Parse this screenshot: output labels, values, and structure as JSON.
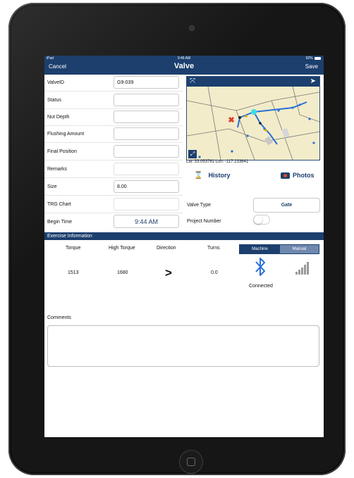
{
  "status_bar": {
    "carrier": "iPad",
    "time": "9:46 AM",
    "battery": "92%"
  },
  "nav": {
    "cancel": "Cancel",
    "title": "Valve",
    "save": "Save"
  },
  "form": {
    "valve_id": {
      "label": "ValveID",
      "value": "G9-039"
    },
    "status": {
      "label": "Status",
      "value": ""
    },
    "nut_depth": {
      "label": "Nut Depth",
      "value": ""
    },
    "flushing_amount": {
      "label": "Flushing Amount",
      "value": ""
    },
    "final_position": {
      "label": "Final Position",
      "value": ""
    },
    "remarks": {
      "label": "Remarks",
      "value": ""
    },
    "size": {
      "label": "Size",
      "value": "8.00"
    },
    "trg_chart": {
      "label": "TRG Chart",
      "value": ""
    },
    "begin_time": {
      "label": "Begin Time",
      "value": "9:44 AM"
    }
  },
  "map": {
    "coordinates": "Lat: 33.053761 Lon: -117.233641",
    "colors": {
      "background": "#f2ecca",
      "pipe": "#2a6fd6",
      "highlight": "#3de0e0",
      "marker": "#e23b2b"
    }
  },
  "history_label": "History",
  "photos_label": "Photos",
  "valve_type": {
    "label": "Valve Type",
    "value": "Gate"
  },
  "project_number": {
    "label": "Project Number",
    "toggle_on": false
  },
  "exercise": {
    "title": "Exercise Information",
    "headers": {
      "torque": "Torque",
      "high_torque": "High Torque",
      "direction": "Direction",
      "turns": "Turns"
    },
    "values": {
      "torque": "1513",
      "high_torque": "1680",
      "direction": ">",
      "turns": "0.0"
    },
    "mode": {
      "machine": "Machine",
      "manual": "Manual",
      "selected": "Machine"
    },
    "bluetooth_status": "Connected"
  },
  "comments": {
    "label": "Comments",
    "value": ""
  },
  "accent_color": "#1c3f6e"
}
